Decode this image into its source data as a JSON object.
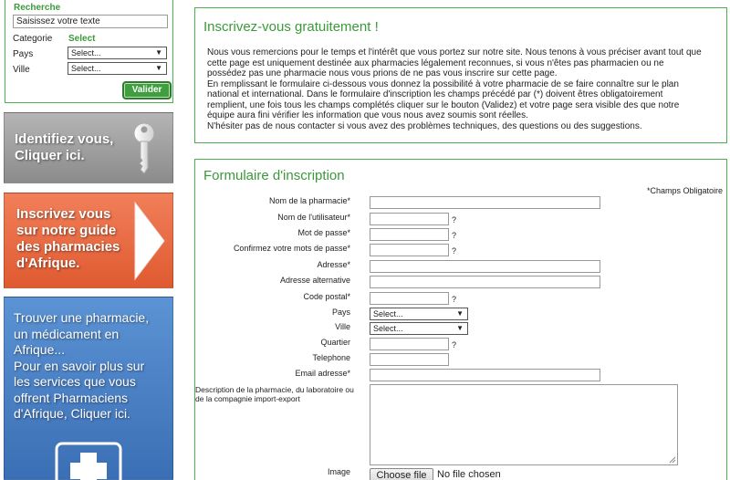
{
  "sidebar": {
    "search": {
      "title": "Recherche",
      "input_value": "Saisissez votre texte",
      "categorie_label": "Categorie",
      "categorie_value": "Select",
      "pays_label": "Pays",
      "pays_value": "Select...",
      "ville_label": "Ville",
      "ville_value": "Select...",
      "submit_label": "Valider"
    },
    "banners": {
      "identify": [
        "Identifiez vous,",
        "Cliquer ici."
      ],
      "register": [
        "Inscrivez vous",
        "sur notre guide",
        "des pharmacies",
        "d'Afrique."
      ],
      "find": [
        "Trouver une pharmacie,",
        "un médicament en",
        "Afrique...",
        "Pour en savoir plus sur",
        "les services que vous",
        "offrent  Pharmaciens",
        "d'Afrique, Cliquer ici."
      ]
    }
  },
  "intro": {
    "title": "Inscrivez-vous gratuitement !",
    "lines": [
      "Nous vous remercions pour le temps et l'intérêt que vous portez sur notre site. Nous tenons à vous préciser avant tout que",
      "cette page est uniquement destinée aux pharmacies légalement reconnues, si vous n'êtes pas pharmacien ou ne",
      "possédez pas une pharmacie nous vous prions de ne pas vous inscrire sur cette page.",
      "En remplissant le formulaire ci-dessous vous donnez la possibilité à votre pharmacie de se faire connaître sur le plan",
      "national et international. Dans le formulaire d'inscription les champs précédé par (*) doivent êtres obligatoirement",
      "remplient, une fois tous les champs complétés cliquer sur le bouton (Validez) et votre page sera visible des que notre",
      "équipe aura fini vérifier les information que vous nous avez soumis sont réelles.",
      "N'hésiter pas de nous contacter si vous avez des problèmes techniques, des questions ou des suggestions."
    ]
  },
  "form": {
    "title": "Formulaire d'inscription",
    "required_note": "*Champs Obligatoire",
    "fields": {
      "nom_pharmacie": "Nom de la pharmacie*",
      "nom_utilisateur": "Nom de l'utilisateur*",
      "mot_de_passe": "Mot de passe*",
      "confirm_mot_de_passe": "Confirmez votre mots de passe*",
      "adresse": "Adresse*",
      "adresse_alt": "Adresse alternative",
      "code_postal": "Code postal*",
      "pays": "Pays",
      "ville": "Ville",
      "quartier": "Quartier",
      "telephone": "Telephone",
      "email": "Email adresse*",
      "description": "Description de la pharmacie, du laboratoire ou de la compagnie import-export",
      "image": "Image"
    },
    "select_placeholder": "Select...",
    "help_mark": "?",
    "file_button": "Choose file",
    "file_status": "No file chosen"
  },
  "colors": {
    "accent_green": "#3a9a3a",
    "border_green": "#4caf50",
    "banner_grey": "#9e9e9e",
    "banner_orange": "#ea6b42",
    "banner_blue": "#4a80c4"
  }
}
